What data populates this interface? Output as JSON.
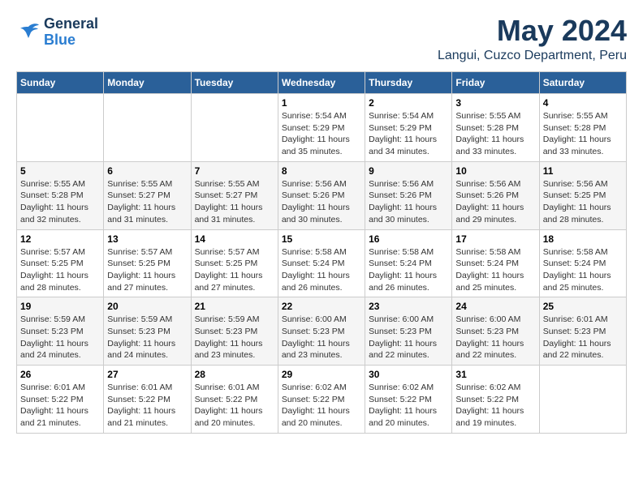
{
  "header": {
    "logo_line1": "General",
    "logo_line2": "Blue",
    "month": "May 2024",
    "location": "Langui, Cuzco Department, Peru"
  },
  "weekdays": [
    "Sunday",
    "Monday",
    "Tuesday",
    "Wednesday",
    "Thursday",
    "Friday",
    "Saturday"
  ],
  "weeks": [
    [
      {
        "day": "",
        "info": ""
      },
      {
        "day": "",
        "info": ""
      },
      {
        "day": "",
        "info": ""
      },
      {
        "day": "1",
        "info": "Sunrise: 5:54 AM\nSunset: 5:29 PM\nDaylight: 11 hours\nand 35 minutes."
      },
      {
        "day": "2",
        "info": "Sunrise: 5:54 AM\nSunset: 5:29 PM\nDaylight: 11 hours\nand 34 minutes."
      },
      {
        "day": "3",
        "info": "Sunrise: 5:55 AM\nSunset: 5:28 PM\nDaylight: 11 hours\nand 33 minutes."
      },
      {
        "day": "4",
        "info": "Sunrise: 5:55 AM\nSunset: 5:28 PM\nDaylight: 11 hours\nand 33 minutes."
      }
    ],
    [
      {
        "day": "5",
        "info": "Sunrise: 5:55 AM\nSunset: 5:28 PM\nDaylight: 11 hours\nand 32 minutes."
      },
      {
        "day": "6",
        "info": "Sunrise: 5:55 AM\nSunset: 5:27 PM\nDaylight: 11 hours\nand 31 minutes."
      },
      {
        "day": "7",
        "info": "Sunrise: 5:55 AM\nSunset: 5:27 PM\nDaylight: 11 hours\nand 31 minutes."
      },
      {
        "day": "8",
        "info": "Sunrise: 5:56 AM\nSunset: 5:26 PM\nDaylight: 11 hours\nand 30 minutes."
      },
      {
        "day": "9",
        "info": "Sunrise: 5:56 AM\nSunset: 5:26 PM\nDaylight: 11 hours\nand 30 minutes."
      },
      {
        "day": "10",
        "info": "Sunrise: 5:56 AM\nSunset: 5:26 PM\nDaylight: 11 hours\nand 29 minutes."
      },
      {
        "day": "11",
        "info": "Sunrise: 5:56 AM\nSunset: 5:25 PM\nDaylight: 11 hours\nand 28 minutes."
      }
    ],
    [
      {
        "day": "12",
        "info": "Sunrise: 5:57 AM\nSunset: 5:25 PM\nDaylight: 11 hours\nand 28 minutes."
      },
      {
        "day": "13",
        "info": "Sunrise: 5:57 AM\nSunset: 5:25 PM\nDaylight: 11 hours\nand 27 minutes."
      },
      {
        "day": "14",
        "info": "Sunrise: 5:57 AM\nSunset: 5:25 PM\nDaylight: 11 hours\nand 27 minutes."
      },
      {
        "day": "15",
        "info": "Sunrise: 5:58 AM\nSunset: 5:24 PM\nDaylight: 11 hours\nand 26 minutes."
      },
      {
        "day": "16",
        "info": "Sunrise: 5:58 AM\nSunset: 5:24 PM\nDaylight: 11 hours\nand 26 minutes."
      },
      {
        "day": "17",
        "info": "Sunrise: 5:58 AM\nSunset: 5:24 PM\nDaylight: 11 hours\nand 25 minutes."
      },
      {
        "day": "18",
        "info": "Sunrise: 5:58 AM\nSunset: 5:24 PM\nDaylight: 11 hours\nand 25 minutes."
      }
    ],
    [
      {
        "day": "19",
        "info": "Sunrise: 5:59 AM\nSunset: 5:23 PM\nDaylight: 11 hours\nand 24 minutes."
      },
      {
        "day": "20",
        "info": "Sunrise: 5:59 AM\nSunset: 5:23 PM\nDaylight: 11 hours\nand 24 minutes."
      },
      {
        "day": "21",
        "info": "Sunrise: 5:59 AM\nSunset: 5:23 PM\nDaylight: 11 hours\nand 23 minutes."
      },
      {
        "day": "22",
        "info": "Sunrise: 6:00 AM\nSunset: 5:23 PM\nDaylight: 11 hours\nand 23 minutes."
      },
      {
        "day": "23",
        "info": "Sunrise: 6:00 AM\nSunset: 5:23 PM\nDaylight: 11 hours\nand 22 minutes."
      },
      {
        "day": "24",
        "info": "Sunrise: 6:00 AM\nSunset: 5:23 PM\nDaylight: 11 hours\nand 22 minutes."
      },
      {
        "day": "25",
        "info": "Sunrise: 6:01 AM\nSunset: 5:23 PM\nDaylight: 11 hours\nand 22 minutes."
      }
    ],
    [
      {
        "day": "26",
        "info": "Sunrise: 6:01 AM\nSunset: 5:22 PM\nDaylight: 11 hours\nand 21 minutes."
      },
      {
        "day": "27",
        "info": "Sunrise: 6:01 AM\nSunset: 5:22 PM\nDaylight: 11 hours\nand 21 minutes."
      },
      {
        "day": "28",
        "info": "Sunrise: 6:01 AM\nSunset: 5:22 PM\nDaylight: 11 hours\nand 20 minutes."
      },
      {
        "day": "29",
        "info": "Sunrise: 6:02 AM\nSunset: 5:22 PM\nDaylight: 11 hours\nand 20 minutes."
      },
      {
        "day": "30",
        "info": "Sunrise: 6:02 AM\nSunset: 5:22 PM\nDaylight: 11 hours\nand 20 minutes."
      },
      {
        "day": "31",
        "info": "Sunrise: 6:02 AM\nSunset: 5:22 PM\nDaylight: 11 hours\nand 19 minutes."
      },
      {
        "day": "",
        "info": ""
      }
    ]
  ]
}
